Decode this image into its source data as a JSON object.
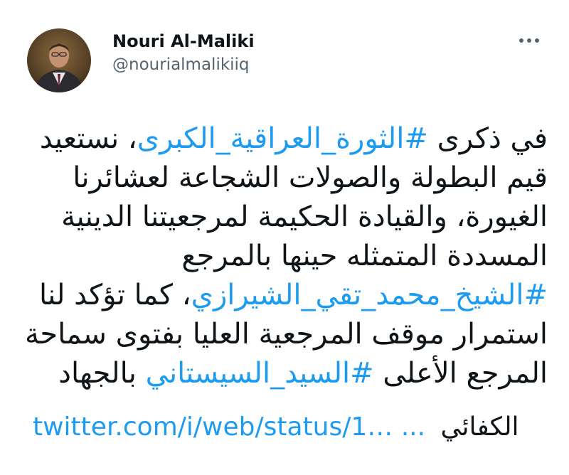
{
  "author": {
    "display_name": "Nouri Al-Maliki",
    "handle": "@nourialmalikiiq"
  },
  "tweet": {
    "line1": {
      "pre": "في ذكرى ",
      "hashtag": "#الثورة_العراقية_الكبرى",
      "post": "، نستعيد"
    },
    "line2": "قيم البطولة والصولات الشجاعة لعشائرنا",
    "line3": "الغيورة، والقيادة الحكيمة لمرجعيتنا الدينية",
    "line4": "المسددة المتمثله حينها بالمرجع",
    "line5": {
      "hashtag": "#الشيخ_محمد_تقي_الشيرازي",
      "post": "، كما تؤكد لنا"
    },
    "line6": "استمرار موقف المرجعية العليا بفتوى سماحة",
    "line7": {
      "pre": "المرجع الأعلى ",
      "hashtag": "#السيد_السيستاني",
      "post": " بالجهاد"
    },
    "line8": {
      "link": "twitter.com/i/web/status/1…",
      "ellipsis": "...",
      "tail": "الكفائي"
    }
  },
  "icons": {
    "more": "more-horizontal-icon",
    "avatar": "profile-photo"
  },
  "colors": {
    "link": "#1d9bf0",
    "text": "#0f1419",
    "secondary": "#536471"
  }
}
